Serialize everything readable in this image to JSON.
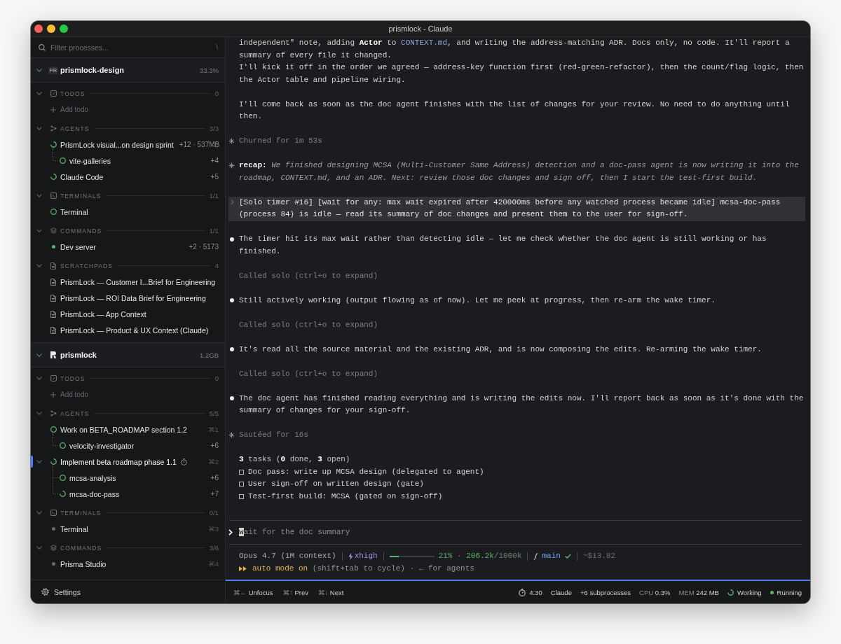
{
  "window": {
    "title": "prismlock - Claude"
  },
  "sidebar": {
    "filter": {
      "placeholder": "Filter processes...",
      "shortcut": "\\"
    },
    "projects": [
      {
        "name": "prismlock-design",
        "badge": "PR",
        "stat": "33.3%",
        "expanded": true,
        "sections": [
          {
            "kind": "todos",
            "title": "TODOS",
            "count": "0",
            "expanded": true,
            "add_label": "Add todo"
          },
          {
            "kind": "agents",
            "title": "AGENTS",
            "count": "3/3",
            "expanded": true,
            "items": [
              {
                "label": "PrismLock visual...on design sprint",
                "kind": "working",
                "meta": "+12 · 537MB",
                "selected": false,
                "timer": false,
                "children": [
                  {
                    "label": "vite-galleries",
                    "kind": "idle",
                    "meta": "+4",
                    "selected": false,
                    "timer": false
                  }
                ]
              },
              {
                "label": "Claude Code",
                "kind": "working",
                "meta": "+5",
                "selected": false,
                "timer": false
              }
            ]
          },
          {
            "kind": "terminals",
            "title": "TERMINALS",
            "count": "1/1",
            "expanded": true,
            "items": [
              {
                "label": "Terminal",
                "kind": "idle",
                "selected": false
              }
            ]
          },
          {
            "kind": "commands",
            "title": "COMMANDS",
            "count": "1/1",
            "expanded": true,
            "items": [
              {
                "label": "Dev server",
                "kind": "running",
                "meta": "+2 · 5173",
                "selected": false
              }
            ]
          },
          {
            "kind": "scratchpads",
            "title": "SCRATCHPADS",
            "count": "4",
            "expanded": true,
            "items": [
              {
                "label": "PrismLock — Customer I...Brief for Engineering",
                "selected": false
              },
              {
                "label": "PrismLock — ROI Data Brief for Engineering",
                "selected": false
              },
              {
                "label": "PrismLock — App Context",
                "selected": false
              },
              {
                "label": "PrismLock — Product & UX Context (Claude)",
                "selected": false
              }
            ]
          }
        ]
      },
      {
        "name": "prismlock",
        "stat": "1.2GB",
        "expanded": true,
        "sections": [
          {
            "kind": "todos",
            "title": "TODOS",
            "count": "0",
            "expanded": true,
            "add_label": "Add todo"
          },
          {
            "kind": "agents",
            "title": "AGENTS",
            "count": "5/5",
            "expanded": true,
            "items": [
              {
                "label": "Work on BETA_ROADMAP section 1.2",
                "kind": "idle",
                "shortcut": "⌘1",
                "selected": false,
                "timer": false,
                "children": [
                  {
                    "label": "velocity-investigator",
                    "kind": "idle",
                    "meta": "+6",
                    "selected": false,
                    "timer": false
                  }
                ]
              },
              {
                "label": "Implement beta roadmap phase 1.1",
                "kind": "working",
                "shortcut": "⌘2",
                "selected": true,
                "timer": true,
                "children": [
                  {
                    "label": "mcsa-analysis",
                    "kind": "idle",
                    "meta": "+6",
                    "selected": false,
                    "timer": false
                  },
                  {
                    "label": "mcsa-doc-pass",
                    "kind": "working",
                    "meta": "+7",
                    "selected": false,
                    "timer": false
                  }
                ]
              }
            ]
          },
          {
            "kind": "terminals",
            "title": "TERMINALS",
            "count": "0/1",
            "expanded": true,
            "items": [
              {
                "label": "Terminal",
                "kind": "stopped",
                "shortcut": "⌘3",
                "selected": false
              }
            ]
          },
          {
            "kind": "commands",
            "title": "COMMANDS",
            "count": "3/6",
            "expanded": true,
            "items": [
              {
                "label": "Prisma Studio",
                "kind": "stopped",
                "shortcut": "⌘4",
                "selected": false
              }
            ]
          }
        ]
      }
    ],
    "settings": {
      "label": "Settings"
    }
  },
  "conversation": {
    "messages": [
      {
        "kind": "text",
        "paragraphs": [
          [
            {
              "kind": "plain",
              "text": "independent\" note, adding "
            },
            {
              "kind": "bold",
              "text": "Actor"
            },
            {
              "kind": "plain",
              "text": " to "
            },
            {
              "kind": "code",
              "text": "CONTEXT.md"
            },
            {
              "kind": "plain",
              "text": ", and writing the address-matching ADR. Docs only, no code. It'll report a summary of every file it changed."
            }
          ],
          [
            {
              "kind": "plain",
              "text": "I'll kick it off in the order we agreed — address-key function first (red-green-refactor), then the count/flag logic, then the Actor table and pipeline wiring."
            }
          ]
        ]
      },
      {
        "kind": "text",
        "paragraphs": [
          [
            {
              "kind": "plain",
              "text": "I'll come back as soon as the doc agent finishes with the list of changes for your review. No need to do anything until then."
            }
          ]
        ]
      },
      {
        "kind": "status",
        "text": "Churned for 1m 53s"
      },
      {
        "kind": "recap",
        "text": "**recap:** *We finished designing MCSA (Multi-Customer Same Address) detection and a doc-pass agent is now writing it into the roadmap, CONTEXT.md, and an ADR. Next: review those doc changes and sign off, then I start the test-first build.*"
      },
      {
        "kind": "user",
        "text": "[Solo timer #16] [wait for any: max wait expired after 420000ms before any watched process became idle] mcsa-doc-pass (process 84) is idle — read its summary of doc changes and present them to the user for sign-off."
      },
      {
        "kind": "assistant",
        "text": "The timer hit its max wait rather than detecting idle — let me check whether the doc agent is still working or has finished."
      },
      {
        "kind": "tool",
        "text": "Called solo (ctrl+o to expand)"
      },
      {
        "kind": "assistant",
        "text": "Still actively working (output flowing as of now). Let me peek at progress, then re-arm the wake timer."
      },
      {
        "kind": "tool",
        "text": "Called solo (ctrl+o to expand)"
      },
      {
        "kind": "assistant",
        "text": "It's read all the source material and the existing ADR, and is now composing the edits. Re-arming the wake timer."
      },
      {
        "kind": "tool",
        "text": "Called solo (ctrl+o to expand)"
      },
      {
        "kind": "assistant",
        "text": "The doc agent has finished reading everything and is writing the edits now. I'll report back as soon as it's done with the summary of changes for your sign-off."
      },
      {
        "kind": "status",
        "text": "Sautéed for 16s"
      },
      {
        "kind": "tasks",
        "summary": "**3** tasks (**0** done, **3** open)",
        "items": [
          {
            "label": "Doc pass: write up MCSA design (delegated to agent)",
            "checked": false
          },
          {
            "label": "User sign-off on written design (gate)",
            "checked": false
          },
          {
            "label": "Test-first build: MCSA (gated on sign-off)",
            "checked": false
          }
        ]
      }
    ]
  },
  "prompt": {
    "placeholder": "wait for the doc summary"
  },
  "status_line": {
    "model": "Opus 4.7 (1M context)",
    "effort": "xhigh",
    "context": {
      "level": 0.21,
      "usage": [
        {
          "kind": "value",
          "text": "21%"
        },
        {
          "kind": "muted",
          "text": " · "
        },
        {
          "kind": "value",
          "text": "206.2k"
        },
        {
          "kind": "muted",
          "text": "/1000k"
        }
      ]
    },
    "branch": {
      "name": "main",
      "clean": true
    },
    "cost": "~$13.82"
  },
  "mode_line": {
    "label": "auto mode on",
    "hint": "(shift+tab to cycle) · ← for agents"
  },
  "footer": {
    "shortcuts": [
      {
        "keys": "⌘←",
        "label": "Unfocus"
      },
      {
        "keys": "⌘↑",
        "label": "Prev"
      },
      {
        "keys": "⌘↓",
        "label": "Next"
      }
    ],
    "timer": "4:30",
    "process": "Claude",
    "subprocesses": "+6 subprocesses",
    "cpu": {
      "label": "CPU",
      "value": "0.3%"
    },
    "memory": {
      "label": "MEM",
      "value": "242 MB"
    },
    "activity": {
      "kind": "working",
      "label": "Working"
    },
    "state": {
      "kind": "running",
      "label": "Running"
    }
  }
}
